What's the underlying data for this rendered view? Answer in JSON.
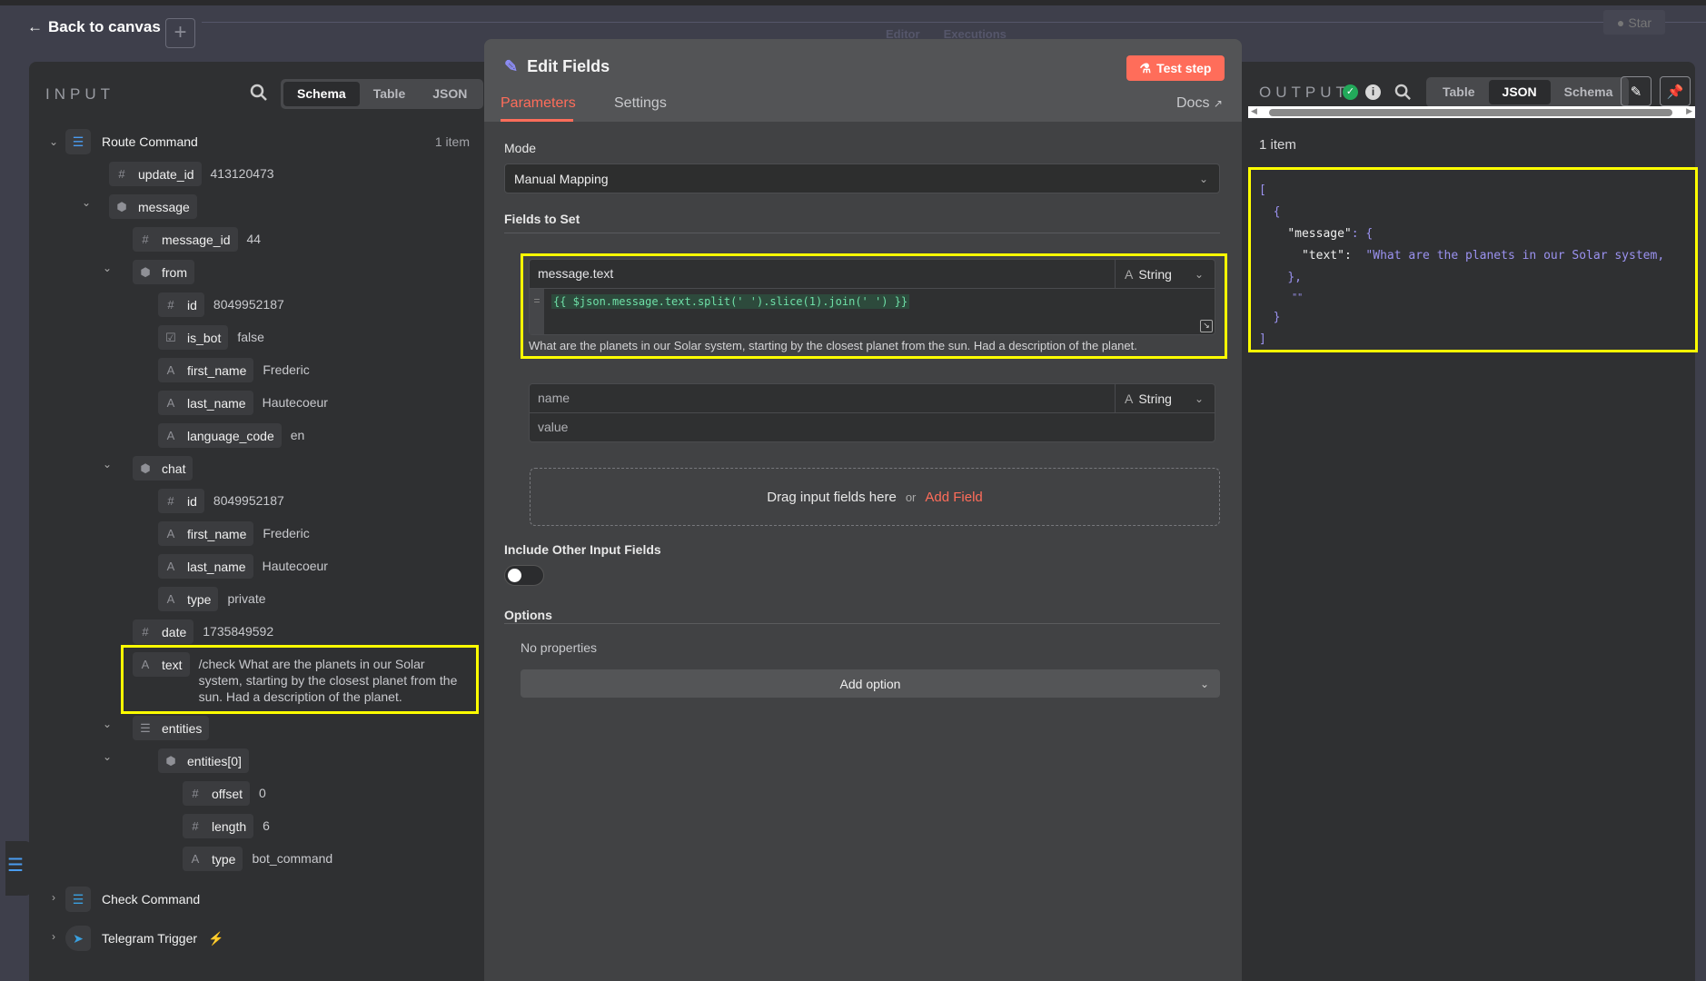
{
  "topbar": {
    "back_label": "Back to canvas",
    "tabs": [
      "Editor",
      "Executions"
    ],
    "star_label": "Star"
  },
  "input": {
    "title": "INPUT",
    "view_tabs": [
      "Schema",
      "Table",
      "JSON"
    ],
    "active_view": "Schema",
    "root": {
      "name": "Route Command",
      "count": "1 item"
    },
    "rows": [
      {
        "level": 1,
        "type": "#",
        "key": "update_id",
        "value": "413120473"
      },
      {
        "level": 1,
        "type": "obj",
        "key": "message",
        "value": "",
        "expanded": true
      },
      {
        "level": 2,
        "type": "#",
        "key": "message_id",
        "value": "44"
      },
      {
        "level": 2,
        "type": "obj",
        "key": "from",
        "value": "",
        "expanded": true
      },
      {
        "level": 3,
        "type": "#",
        "key": "id",
        "value": "8049952187"
      },
      {
        "level": 3,
        "type": "bool",
        "key": "is_bot",
        "value": "false"
      },
      {
        "level": 3,
        "type": "A",
        "key": "first_name",
        "value": "Frederic"
      },
      {
        "level": 3,
        "type": "A",
        "key": "last_name",
        "value": "Hautecoeur"
      },
      {
        "level": 3,
        "type": "A",
        "key": "language_code",
        "value": "en"
      },
      {
        "level": 2,
        "type": "obj",
        "key": "chat",
        "value": "",
        "expanded": true
      },
      {
        "level": 3,
        "type": "#",
        "key": "id",
        "value": "8049952187"
      },
      {
        "level": 3,
        "type": "A",
        "key": "first_name",
        "value": "Frederic"
      },
      {
        "level": 3,
        "type": "A",
        "key": "last_name",
        "value": "Hautecoeur"
      },
      {
        "level": 3,
        "type": "A",
        "key": "type",
        "value": "private"
      },
      {
        "level": 2,
        "type": "#",
        "key": "date",
        "value": "1735849592"
      },
      {
        "level": 2,
        "type": "A",
        "key": "text",
        "value": "/check What are the planets in our Solar system, starting by the closest planet from the sun. Had a description of the planet.",
        "highlight": true
      },
      {
        "level": 2,
        "type": "list",
        "key": "entities",
        "value": "",
        "expanded": true
      },
      {
        "level": 3,
        "type": "obj",
        "key": "entities[0]",
        "value": "",
        "expanded": true
      },
      {
        "level": 4,
        "type": "#",
        "key": "offset",
        "value": "0"
      },
      {
        "level": 4,
        "type": "#",
        "key": "length",
        "value": "6"
      },
      {
        "level": 4,
        "type": "A",
        "key": "type",
        "value": "bot_command"
      }
    ],
    "other_nodes": [
      {
        "name": "Check Command",
        "icon": "signpost-icon"
      },
      {
        "name": "Telegram Trigger",
        "icon": "telegram-icon",
        "trigger": true
      }
    ]
  },
  "editor": {
    "title": "Edit Fields",
    "test_step_label": "Test step",
    "tabs": [
      "Parameters",
      "Settings"
    ],
    "active_tab": "Parameters",
    "docs_label": "Docs",
    "mode_label": "Mode",
    "mode_value": "Manual Mapping",
    "fields_label": "Fields to Set",
    "fields": [
      {
        "name": "message.text",
        "type": "String",
        "expression": "{{ $json.message.text.split(' ').slice(1).join(' ') }}",
        "result": "What are the planets in our Solar system, starting by the closest planet from the sun. Had a description of the planet."
      },
      {
        "name_placeholder": "name",
        "type": "String",
        "value_placeholder": "value"
      }
    ],
    "drop_text": "Drag input fields here",
    "drop_or": "or",
    "add_field_label": "Add Field",
    "include_label": "Include Other Input Fields",
    "include_on": false,
    "options_label": "Options",
    "no_properties": "No properties",
    "add_option_label": "Add option"
  },
  "output": {
    "title": "OUTPUT",
    "view_tabs": [
      "Table",
      "JSON",
      "Schema"
    ],
    "active_view": "JSON",
    "count": "1 item",
    "json": {
      "open_arr": "[",
      "open_obj": "{",
      "key_message": "\"message\"",
      "colon_open": ": {",
      "key_text": "\"text\"",
      "text_value": "\"What are the planets in our Solar system,",
      "close_inner": "},",
      "empty": "\"\"",
      "close_obj": "}",
      "close_arr": "]"
    }
  },
  "colors": {
    "accent": "#ff6d5a",
    "highlight": "#ffff00",
    "json_value": "#9b92f0",
    "success": "#22a95a"
  }
}
